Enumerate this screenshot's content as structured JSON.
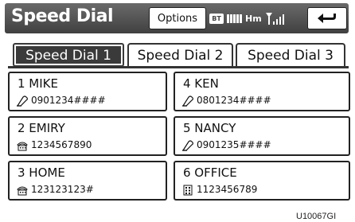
{
  "header": {
    "title": "Speed Dial",
    "options_label": "Options",
    "bt_label": "BT",
    "hm_label": "Hm"
  },
  "tabs": [
    {
      "label": "Speed Dial 1",
      "active": true
    },
    {
      "label": "Speed Dial 2",
      "active": false
    },
    {
      "label": "Speed Dial 3",
      "active": false
    }
  ],
  "entries": [
    {
      "name": "1 MIKE",
      "number": "0901234####",
      "icon": "mobile-phone-icon"
    },
    {
      "name": "4 KEN",
      "number": "0801234####",
      "icon": "mobile-phone-icon"
    },
    {
      "name": "2 EMIRY",
      "number": "1234567890",
      "icon": "home-phone-icon"
    },
    {
      "name": "5 NANCY",
      "number": "0901235####",
      "icon": "mobile-phone-icon"
    },
    {
      "name": "3 HOME",
      "number": "123123123#",
      "icon": "home-phone-icon"
    },
    {
      "name": "6 OFFICE",
      "number": "1123456789",
      "icon": "office-phone-icon"
    }
  ],
  "image_code": "U10067GI"
}
